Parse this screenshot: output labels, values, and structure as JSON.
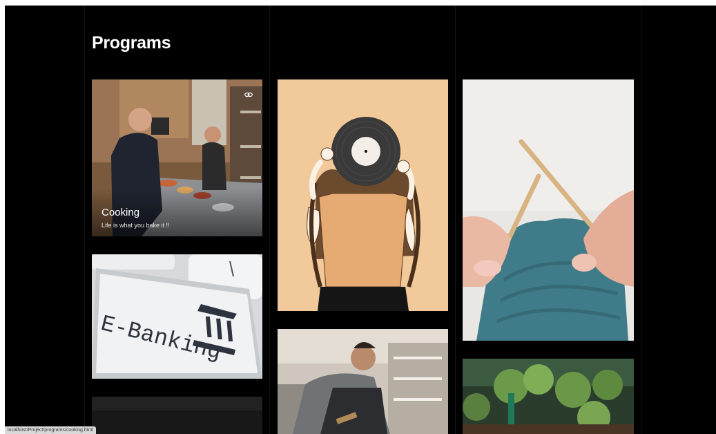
{
  "page": {
    "title": "Programs"
  },
  "colors": {
    "background": "#000000",
    "title_text": "#ffffff",
    "vinyl_bg": "#f2c99a"
  },
  "cards": {
    "cooking": {
      "title": "Cooking",
      "subtitle": "Life is what you bake it !!",
      "icon": "link-icon"
    },
    "banking": {
      "key_text": "E-Banking",
      "icon": "bank-icon"
    },
    "music": {
      "icon": "vinyl-record-icon"
    },
    "knitting": {
      "icon": "knitting-needles-icon"
    },
    "woodwork": {
      "icon": "craftsman-icon"
    },
    "gardening": {
      "icon": "seedlings-icon"
    },
    "dark": {
      "icon": "image-placeholder-icon"
    }
  },
  "status_bar": {
    "text": "localhost/Project/programs/cooking.html"
  }
}
